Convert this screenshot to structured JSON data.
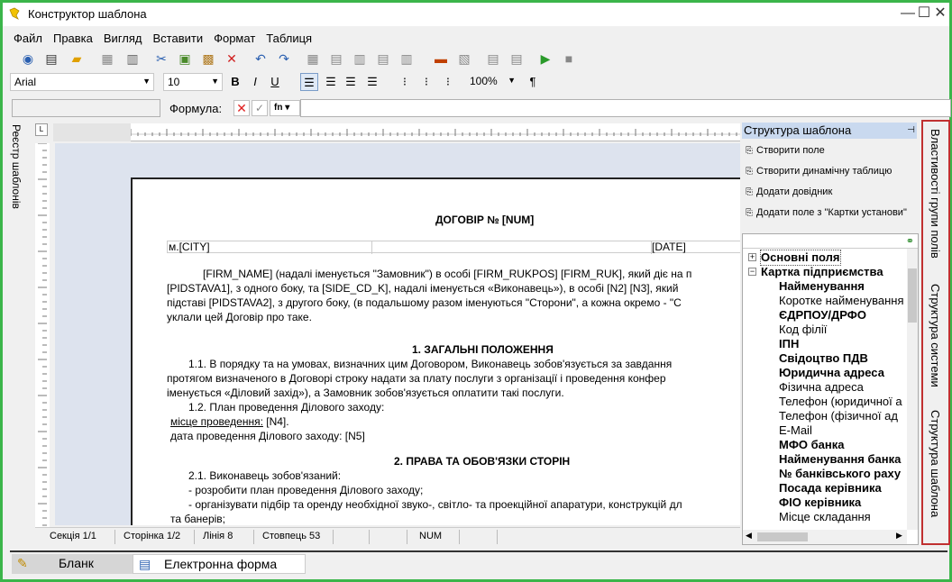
{
  "window": {
    "title": "Конструктор шаблона"
  },
  "menu": [
    "Файл",
    "Правка",
    "Вигляд",
    "Вставити",
    "Формат",
    "Таблиця"
  ],
  "format_toolbar": {
    "font_name": "Arial",
    "font_size": "10",
    "bold": "B",
    "italic": "I",
    "underline": "U",
    "zoom": "100%",
    "pilcrow": "¶"
  },
  "formula": {
    "label": "Формула:",
    "fn_label": "fn"
  },
  "left_tab": "Реєстр шаблонів",
  "document": {
    "title": "ДОГОВІР № [NUM]",
    "city": "м.[CITY]",
    "date": "[DATE]",
    "intro": [
      "[FIRM_NAME] (надалі іменується \"Замовник\") в особі [FIRM_RUKPOS] [FIRM_RUK], який діє на п",
      "[PIDSTAVA1], з одного боку, та [SIDE_CD_K], надалі іменується  «Виконавець»), в особі [N2] [N3], який",
      "підставі [PIDSTAVA2], з другого боку,  (в подальшому разом іменуються \"Сторони\", а кожна окремо - \"С",
      "уклали цей Договір про таке."
    ],
    "section1_title": "1. ЗАГАЛЬНІ ПОЛОЖЕННЯ",
    "section1": [
      "1.1. В порядку та на умовах, визначних цим Договором, Виконавець зобов'язується за завдання",
      "протягом визначеного в Договорі строку надати за плату послуги з організації і проведення конфер",
      "іменується «Діловий захід»), а Замовник зобов'язується оплатити такі послуги.",
      "1.2. План проведення Ділового заходу:"
    ],
    "place_label": "місце проведення:",
    "place_value": " [N4].",
    "date_line": "дата проведення Ділового заходу: [N5]",
    "section2_title": "2. ПРАВА ТА ОБОВ'ЯЗКИ СТОРІН",
    "section2": [
      "2.1. Виконавець зобов'язаний:",
      "-  розробити план проведення Ділового заходу;",
      "- організувати підбір та оренду необхідної звуко-, світло- та проекційної апаратури, конструкцій дл",
      "та банерів;"
    ]
  },
  "status": {
    "section": "Секція 1/1",
    "page": "Сторінка 1/2",
    "line": "Лінія 8",
    "column": "Стовпець 53",
    "num": "NUM"
  },
  "panel": {
    "title": "Структура шаблона",
    "actions": [
      "Створити поле",
      "Створити динамічну таблицю",
      "Додати довідник",
      "Додати поле з \"Картки установи\""
    ],
    "tree": [
      {
        "label": "Основні поля",
        "bold": true,
        "level": 0,
        "expander": "+"
      },
      {
        "label": "Картка підприємства",
        "bold": true,
        "level": 0,
        "expander": "−"
      },
      {
        "label": "Найменування",
        "bold": true,
        "level": 1
      },
      {
        "label": "Коротке найменування",
        "bold": false,
        "level": 1
      },
      {
        "label": "ЄДРПОУ/ДРФО",
        "bold": true,
        "level": 1
      },
      {
        "label": "Код філії",
        "bold": false,
        "level": 1
      },
      {
        "label": "ІПН",
        "bold": true,
        "level": 1
      },
      {
        "label": "Свідоцтво ПДВ",
        "bold": true,
        "level": 1
      },
      {
        "label": "Юридична адреса",
        "bold": true,
        "level": 1
      },
      {
        "label": "Фізична адреса",
        "bold": false,
        "level": 1
      },
      {
        "label": "Телефон (юридичної а",
        "bold": false,
        "level": 1
      },
      {
        "label": "Телефон (фізичної ад",
        "bold": false,
        "level": 1
      },
      {
        "label": "E-Mail",
        "bold": false,
        "level": 1
      },
      {
        "label": "МФО банка",
        "bold": true,
        "level": 1
      },
      {
        "label": "Найменування банка",
        "bold": true,
        "level": 1
      },
      {
        "label": "№ банківського раху",
        "bold": true,
        "level": 1
      },
      {
        "label": "Посада керівника",
        "bold": true,
        "level": 1
      },
      {
        "label": "ФІО керівника",
        "bold": true,
        "level": 1
      },
      {
        "label": "Місце складання",
        "bold": false,
        "level": 1
      }
    ]
  },
  "side_tabs": [
    "Властивості групи полів",
    "Структура системи",
    "Структура шаблона"
  ],
  "bottom_tabs": [
    "Бланк",
    "Електронна форма"
  ],
  "colors": {
    "window_border": "#3bb54a",
    "panel_header": "#c9d9ef",
    "highlight_border": "#c03030",
    "doc_background": "#dde3ee"
  }
}
